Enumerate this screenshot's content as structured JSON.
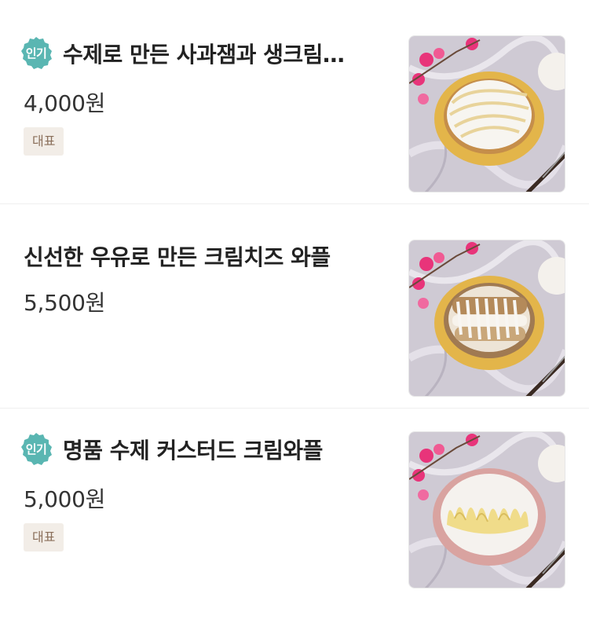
{
  "menu": {
    "items": [
      {
        "name": "수제로 만든 사과잼과 생크림…",
        "price": "4,000원",
        "badge": "인기",
        "tag": "대표",
        "image": "waffle-apple-jam-cream-photo",
        "plate_color": "#e3b54a",
        "topping": "white-cream-drizzle"
      },
      {
        "name": "신선한 우유로 만든 크림치즈 와플",
        "price": "5,500원",
        "image": "waffle-cream-cheese-photo",
        "plate_color": "#e3b54a",
        "topping": "cream-cheese-cinnamon"
      },
      {
        "name": "명품 수제 커스터드 크림와플",
        "price": "5,000원",
        "badge": "인기",
        "tag": "대표",
        "image": "waffle-custard-cream-photo",
        "plate_color": "#d9a3a0",
        "topping": "yellow-custard"
      }
    ]
  },
  "colors": {
    "badge": "#5ab6b2",
    "tag_bg": "#f2ede7",
    "tag_text": "#8a6f5a",
    "divider": "#efefef"
  }
}
